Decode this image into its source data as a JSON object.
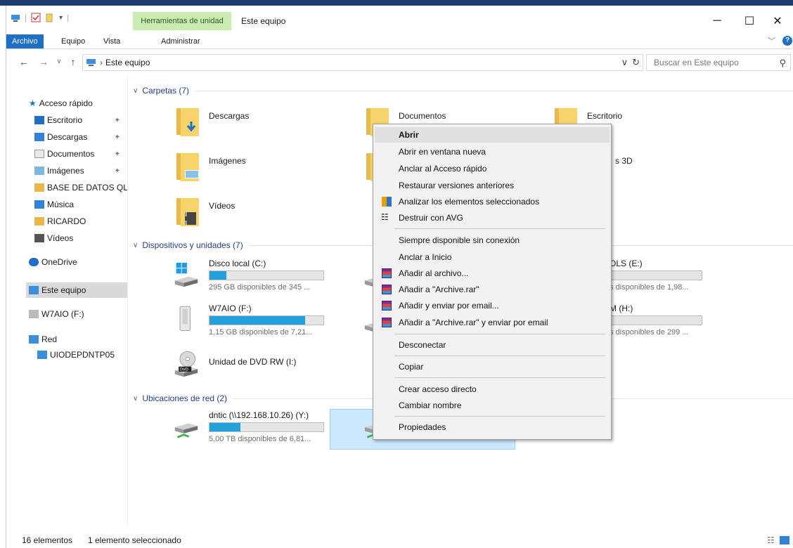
{
  "window": {
    "title": "Este equipo",
    "context_tab": "Herramientas de unidad"
  },
  "ribbon": {
    "tabs": [
      "Archivo",
      "Equipo",
      "Vista"
    ],
    "manage": "Administrar"
  },
  "address": {
    "path": "Este equipo",
    "search_placeholder": "Buscar en Este equipo"
  },
  "nav": {
    "quick_access": "Acceso rápido",
    "items": [
      "Escritorio",
      "Descargas",
      "Documentos",
      "Imágenes",
      "BASE DE DATOS QL",
      "Música",
      "RICARDO",
      "Vídeos"
    ],
    "onedrive": "OneDrive",
    "this_pc": "Este equipo",
    "w7aio": "W7AIO (F:)",
    "network": "Red",
    "network_host": "UIODEPDNTP05"
  },
  "groups": {
    "folders": "Carpetas (7)",
    "devices": "Dispositivos y unidades (7)",
    "network": "Ubicaciones de red (2)"
  },
  "folders": [
    "Descargas",
    "Documentos",
    "Escritorio",
    "Imágenes",
    "Vídeos",
    "s 3D"
  ],
  "drives": {
    "c": {
      "label": "Disco local (C:)",
      "sub": "295 GB disponibles de 345 ...",
      "used": 0.15
    },
    "e": {
      "label": "OLS (E:)",
      "sub": "s disponibles de 1,98..."
    },
    "f": {
      "label": "W7AIO (F:)",
      "sub": "1,15 GB disponibles de 7,21...",
      "used": 0.84
    },
    "h": {
      "label": "M (H:)",
      "sub": "s disponibles de 299 ..."
    },
    "i": {
      "label": "Unidad de DVD RW (I:)"
    },
    "y": {
      "label": "dntic (\\\\192.168.10.26) (Y:)",
      "sub": "5,00 TB disponibles de 6,81...",
      "used": 0.27
    }
  },
  "context_menu": {
    "open": "Abrir",
    "open_new": "Abrir en ventana nueva",
    "pin_quick": "Anclar al Acceso rápido",
    "restore": "Restaurar versiones anteriores",
    "scan": "Analizar los elementos seleccionados",
    "shred": "Destruir con AVG",
    "offline": "Siempre disponible sin conexión",
    "pin_start": "Anclar a Inicio",
    "add_archive": "Añadir al archivo...",
    "add_rar": "Añadir a \"Archive.rar\"",
    "add_email": "Añadir y enviar por email...",
    "add_rar_email": "Añadir a \"Archive.rar\" y enviar por email",
    "disconnect": "Desconectar",
    "copy": "Copiar",
    "shortcut": "Crear acceso directo",
    "rename": "Cambiar nombre",
    "properties": "Propiedades"
  },
  "status": {
    "count": "16 elementos",
    "selected": "1 elemento seleccionado"
  },
  "colors": {
    "accent": "#1e6fc6",
    "bar": "#26a0da",
    "selection": "#cce8ff"
  }
}
